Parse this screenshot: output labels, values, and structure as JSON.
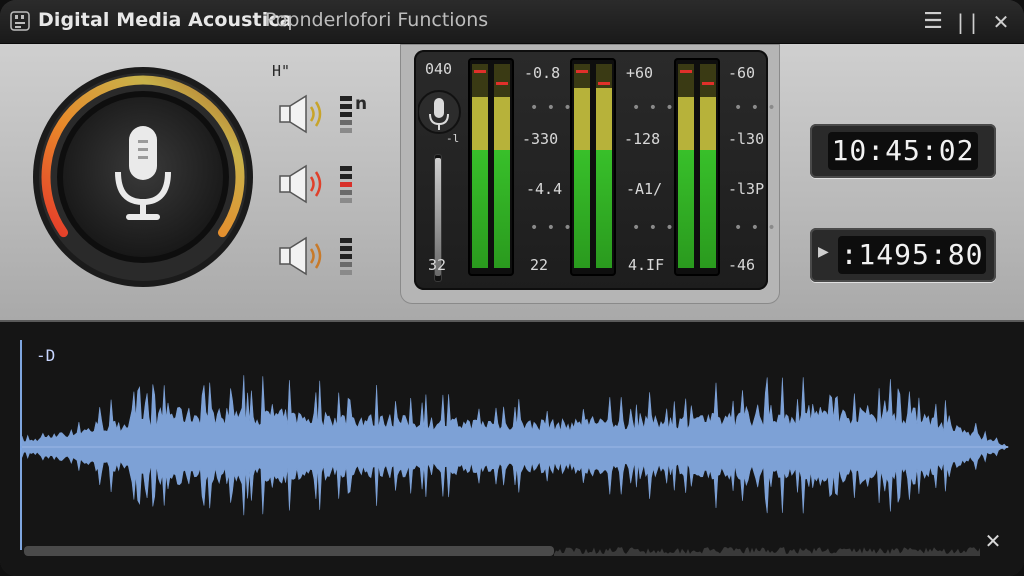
{
  "window": {
    "title_bold": "Digital Media Acoustica",
    "title_rest": "Popnderlofori Functions"
  },
  "titlebar_controls": [
    {
      "icon": "hamburger-menu-icon",
      "glyph": "☰"
    },
    {
      "icon": "pause-bars-icon",
      "glyph": "| |"
    },
    {
      "icon": "close-icon",
      "glyph": "✕"
    }
  ],
  "mic_knob": {
    "icon": "microphone-icon",
    "arc_colors": [
      "#e53a2a",
      "#e88a2a",
      "#c8b24a",
      "#b06a2a"
    ]
  },
  "speaker_labels": {
    "top_label": "H\"",
    "side_label": "n"
  },
  "speakers": [
    {
      "icon": "speaker-icon",
      "wave_color": "#c8a42a"
    },
    {
      "icon": "speaker-icon",
      "wave_color": "#e0402a"
    },
    {
      "icon": "speaker-icon",
      "wave_color": "#c87a2a"
    }
  ],
  "meters": {
    "gain_top": "040",
    "gain_bottom": "32",
    "mic_icon": "microphone-small-icon",
    "mic_sub": "-l",
    "scales": [
      {
        "top": "-0.8",
        "mid1": "-330",
        "mid2": "-4.4",
        "bottom": "22"
      },
      {
        "top": "+60",
        "mid1": "-128",
        "mid2": "-A1/",
        "bottom": "4.IF"
      },
      {
        "top": "-60",
        "mid1": "-l30",
        "mid2": "-l3P",
        "bottom": "-46"
      }
    ],
    "dots": "• • •",
    "colors": {
      "green": "#38c02a",
      "yellow": "#b7b23a",
      "olive": "#3a3a14",
      "peak": "#e0302a"
    }
  },
  "displays": {
    "clock": "10:45:02",
    "counter": ":1495:80",
    "play_icon": "play-triangle-icon",
    "play_glyph": "▶"
  },
  "waveform": {
    "label": "-D",
    "color": "#7da1d6",
    "close_glyph": "✕"
  }
}
